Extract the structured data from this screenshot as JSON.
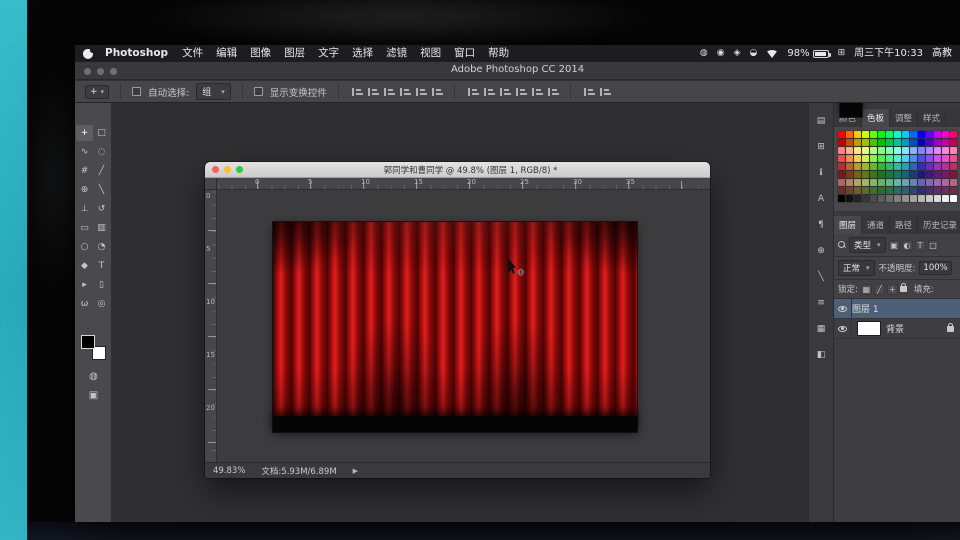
{
  "menu_bar": {
    "app_name": "Photoshop",
    "menus": [
      "文件",
      "编辑",
      "图像",
      "图层",
      "文字",
      "选择",
      "滤镜",
      "视图",
      "窗口",
      "帮助"
    ],
    "status_icons": [
      {
        "name": "notification-center-icon",
        "glyph": "◍"
      },
      {
        "name": "screen-record-icon",
        "glyph": "◉"
      },
      {
        "name": "input-source-icon",
        "glyph": "◈"
      },
      {
        "name": "reminder-bell-icon",
        "glyph": "◒"
      }
    ],
    "battery_percent": "98%",
    "spotlight_grid_glyph": "⊞",
    "time": "周三下午10:33",
    "right_badge": "高教"
  },
  "app_titlebar": {
    "title": "Adobe Photoshop CC 2014"
  },
  "options_bar": {
    "active_tool_glyph": "+",
    "dropdown_caret": "▾",
    "auto_select_label": "自动选择:",
    "auto_select_value": "组",
    "show_transform_label": "显示变换控件",
    "align_icons": [
      "align-left-edges",
      "align-horizontal-centers",
      "align-right-edges",
      "align-top-edges",
      "align-vertical-centers",
      "align-bottom-edges"
    ],
    "distribute_icons": [
      "distribute-top-edges",
      "distribute-vertical-centers",
      "distribute-bottom-edges",
      "distribute-left-edges",
      "distribute-horizontal-centers",
      "distribute-right-edges"
    ],
    "extra_icons": [
      "auto-align-layers",
      "3d-mode"
    ]
  },
  "toolbar": {
    "tools": [
      {
        "name": "move-tool",
        "glyph": "+",
        "active": true
      },
      {
        "name": "marquee-tool",
        "glyph": "□",
        "active": false
      },
      {
        "name": "lasso-tool",
        "glyph": "∿",
        "active": false
      },
      {
        "name": "quick-selection-tool",
        "glyph": "◌",
        "active": false
      },
      {
        "name": "crop-tool",
        "glyph": "#",
        "active": false
      },
      {
        "name": "eyedropper-tool",
        "glyph": "╱",
        "active": false
      },
      {
        "name": "healing-brush-tool",
        "glyph": "⊕",
        "active": false
      },
      {
        "name": "brush-tool",
        "glyph": "╲",
        "active": false
      },
      {
        "name": "clone-stamp-tool",
        "glyph": "⊥",
        "active": false
      },
      {
        "name": "history-brush-tool",
        "glyph": "↺",
        "active": false
      },
      {
        "name": "eraser-tool",
        "glyph": "▭",
        "active": false
      },
      {
        "name": "gradient-tool",
        "glyph": "▥",
        "active": false
      },
      {
        "name": "blur-tool",
        "glyph": "○",
        "active": false
      },
      {
        "name": "dodge-tool",
        "glyph": "◔",
        "active": false
      },
      {
        "name": "pen-tool",
        "glyph": "◆",
        "active": false
      },
      {
        "name": "type-tool",
        "glyph": "T",
        "active": false
      },
      {
        "name": "path-selection-tool",
        "glyph": "▸",
        "active": false
      },
      {
        "name": "shape-tool",
        "glyph": "▯",
        "active": false
      },
      {
        "name": "hand-tool",
        "glyph": "ω",
        "active": false
      },
      {
        "name": "zoom-tool",
        "glyph": "◎",
        "active": false
      }
    ]
  },
  "document_window": {
    "title": "郭同学和曹同学 @ 49.8% (图层 1, RGB/8) *",
    "ruler_top_labels": [
      "0",
      "5",
      "10",
      "15",
      "20",
      "25",
      "30",
      "35"
    ],
    "ruler_left_labels": [
      "0",
      "5",
      "10",
      "15",
      "20"
    ],
    "status_zoom": "49.83%",
    "status_doc": "文档:5.93M/6.89M",
    "status_arrow": "▶"
  },
  "panels": {
    "top_tabs": [
      {
        "label": "颜色",
        "active": false
      },
      {
        "label": "色板",
        "active": true
      },
      {
        "label": "调整",
        "active": false
      },
      {
        "label": "样式",
        "active": false
      }
    ],
    "swatches": {
      "columns": 15,
      "hues": [
        0,
        24,
        48,
        72,
        96,
        120,
        144,
        168,
        192,
        216,
        240,
        264,
        288,
        312,
        336
      ],
      "tone_rows": [
        [
          100,
          50
        ],
        [
          100,
          38
        ],
        [
          95,
          75
        ],
        [
          85,
          62
        ],
        [
          60,
          45
        ],
        [
          65,
          28
        ],
        [
          35,
          55
        ],
        [
          40,
          30
        ]
      ],
      "include_grayscale_row": true
    },
    "mid_tabs": [
      {
        "label": "图层",
        "active": true
      },
      {
        "label": "通道",
        "active": false
      },
      {
        "label": "路径",
        "active": false
      },
      {
        "label": "历史记录",
        "active": false
      }
    ],
    "layers": {
      "filter_label": "类型",
      "filter_icons": [
        {
          "name": "filter-pixel-layers-icon",
          "glyph": "▣"
        },
        {
          "name": "filter-adjustment-layers-icon",
          "glyph": "◐"
        },
        {
          "name": "filter-type-layers-icon",
          "glyph": "T"
        },
        {
          "name": "filter-shape-layers-icon",
          "glyph": "□"
        }
      ],
      "blend_mode": "正常",
      "opacity_label": "不透明度:",
      "opacity_value": "100%",
      "lock_label": "锁定:",
      "lock_icons": [
        {
          "name": "lock-transparent-pixels-icon",
          "glyph": "▦"
        },
        {
          "name": "lock-image-pixels-icon",
          "glyph": "╱"
        },
        {
          "name": "lock-position-icon",
          "glyph": "+"
        },
        {
          "name": "lock-all-icon",
          "glyph": "lock"
        }
      ],
      "fill_label": "填充:",
      "rows": [
        {
          "label": "图层 1",
          "selected": true,
          "thumb": "curtain",
          "visible": true,
          "locked": false
        },
        {
          "label": "背景",
          "selected": false,
          "thumb": "white",
          "visible": true,
          "locked": true
        }
      ]
    },
    "dock_icons": [
      {
        "name": "histogram-panel-icon",
        "glyph": "▤"
      },
      {
        "name": "navigator-panel-icon",
        "glyph": "⊞"
      },
      {
        "name": "info-panel-icon",
        "glyph": "ℹ"
      },
      {
        "name": "character-panel-icon",
        "glyph": "A"
      },
      {
        "name": "paragraph-panel-icon",
        "glyph": "¶"
      },
      {
        "name": "clone-source-panel-icon",
        "glyph": "⊕"
      },
      {
        "name": "brush-panel-icon",
        "glyph": "╲"
      },
      {
        "name": "brush-presets-panel-icon",
        "glyph": "≡"
      },
      {
        "name": "timeline-panel-icon",
        "glyph": "▦"
      },
      {
        "name": "properties-panel-icon",
        "glyph": "◧"
      }
    ]
  }
}
